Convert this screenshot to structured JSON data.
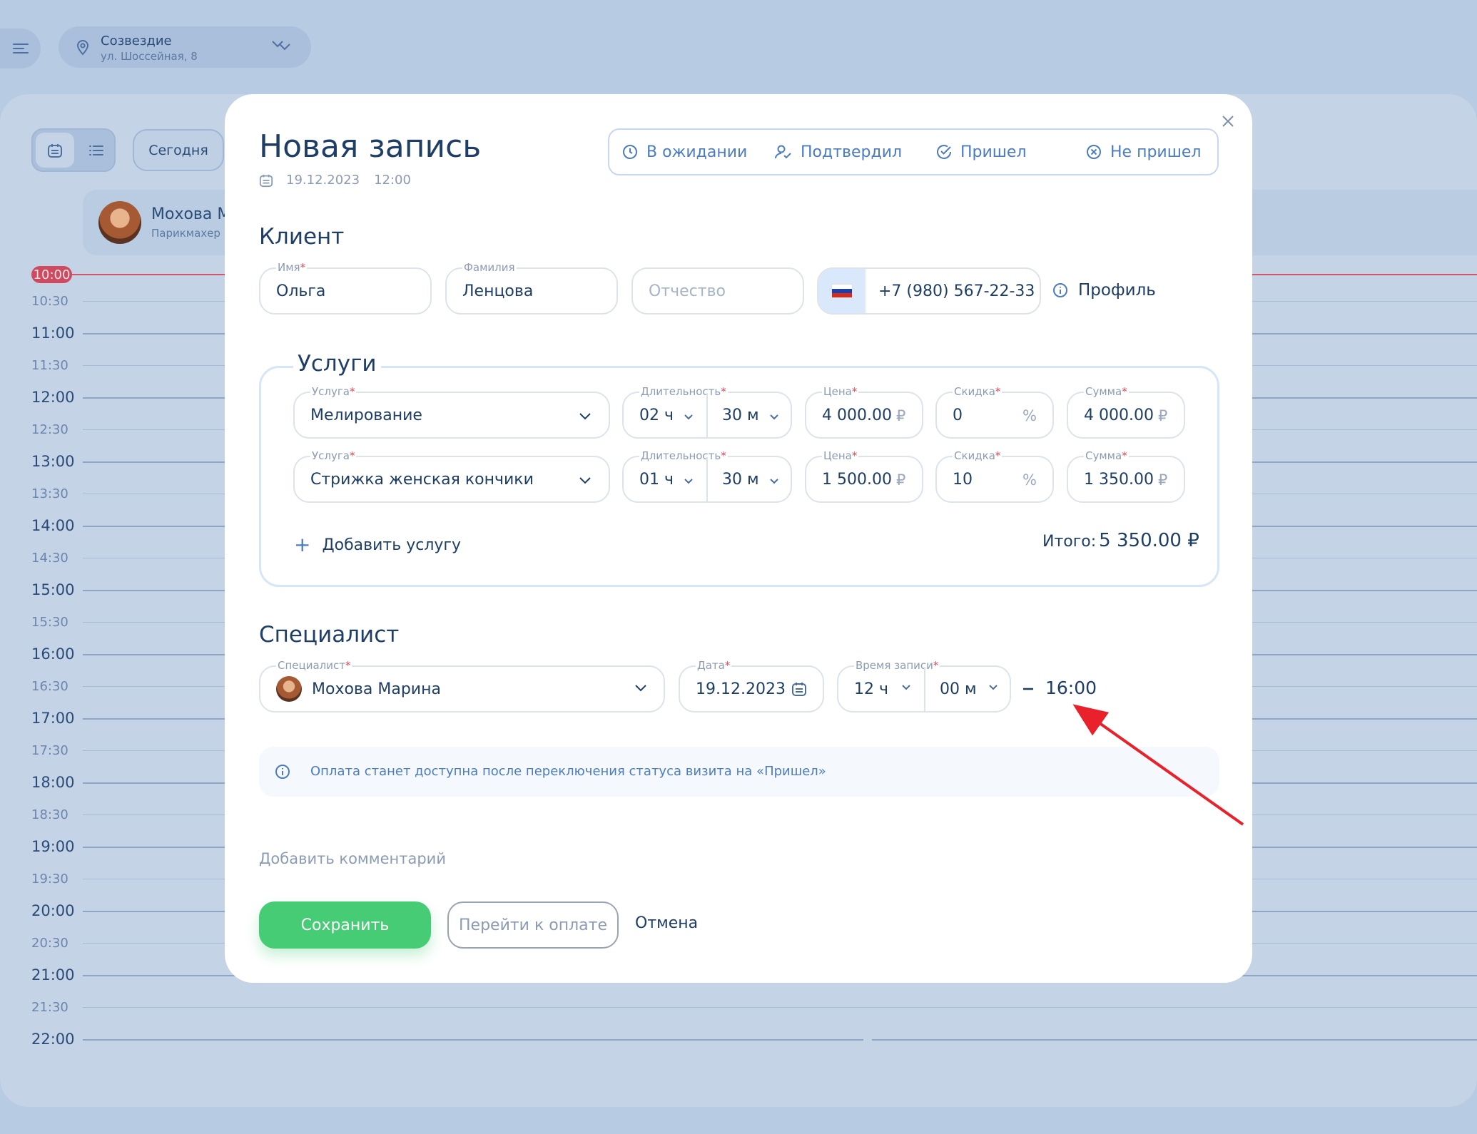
{
  "location": {
    "name": "Созвездие",
    "address": "ул. Шоссейная, 8"
  },
  "toolbar": {
    "today": "Сегодня"
  },
  "background_specialist": {
    "name": "Мохова М",
    "role": "Парикмахер"
  },
  "timeline": {
    "now": "10:00",
    "labels": [
      "10:30",
      "11:00",
      "11:30",
      "12:00",
      "12:30",
      "13:00",
      "13:30",
      "14:00",
      "14:30",
      "15:00",
      "15:30",
      "16:00",
      "16:30",
      "17:00",
      "17:30",
      "18:00",
      "18:30",
      "19:00",
      "19:30",
      "20:00",
      "20:30",
      "21:00",
      "21:30",
      "22:00"
    ]
  },
  "modal": {
    "title": "Новая запись",
    "date": "19.12.2023",
    "time": "12:00",
    "statuses": [
      "В ожидании",
      "Подтвердил",
      "Пришел",
      "Не пришел"
    ],
    "client": {
      "section": "Клиент",
      "first_name_label": "Имя",
      "first_name": "Ольга",
      "last_name_label": "Фамилия",
      "last_name": "Ленцова",
      "patronymic_placeholder": "Отчество",
      "phone": "+7 (980) 567-22-33",
      "profile": "Профиль"
    },
    "services": {
      "section": "Услуги",
      "service_label": "Услуга",
      "duration_label": "Длительность",
      "price_label": "Цена",
      "discount_label": "Скидка",
      "sum_label": "Сумма",
      "currency": "₽",
      "percent": "%",
      "rows": [
        {
          "service": "Мелирование",
          "hours": "02 ч",
          "minutes": "30 м",
          "price": "4 000.00",
          "discount": "0",
          "sum": "4 000.00"
        },
        {
          "service": "Стрижка женская кончики",
          "hours": "01 ч",
          "minutes": "30 м",
          "price": "1 500.00",
          "discount": "10",
          "sum": "1 350.00"
        }
      ],
      "add": "Добавить услугу",
      "total_label": "Итого:",
      "total_value": "5 350.00 ₽"
    },
    "specialist": {
      "section": "Специалист",
      "specialist_label": "Специалист",
      "specialist": "Мохова Марина",
      "date_label": "Дата",
      "date": "19.12.2023",
      "time_label": "Время записи",
      "hours": "12 ч",
      "minutes": "00 м",
      "end_time": "16:00"
    },
    "info": "Оплата станет доступна после переключения статуса визита на «Пришел»",
    "add_comment": "Добавить комментарий",
    "buttons": {
      "save": "Сохранить",
      "pay": "Перейти к оплате",
      "cancel": "Отмена"
    }
  },
  "colors": {
    "accent": "#4b7cbf",
    "save": "#47cc76",
    "required": "#e0485b",
    "annotation": "#e8212b"
  }
}
